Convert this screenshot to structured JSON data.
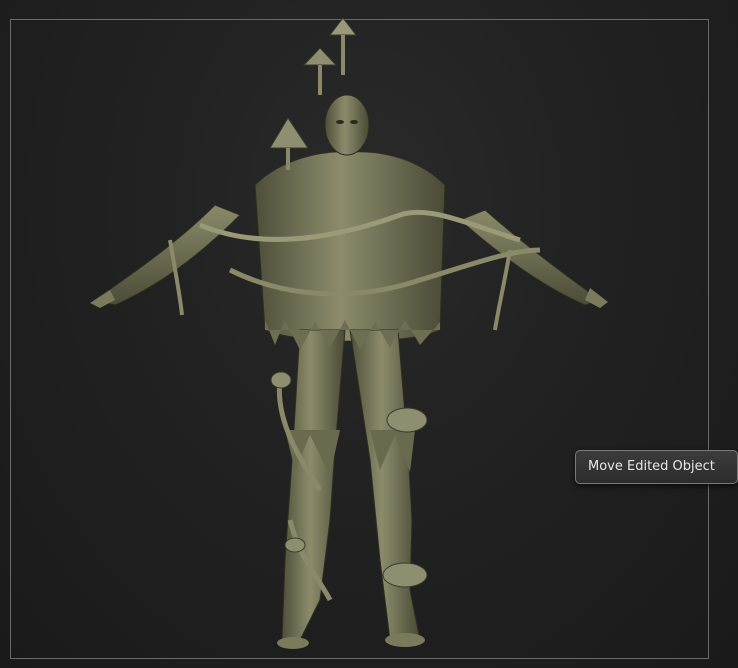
{
  "viewport": {
    "tooltip_text": "Move Edited Object",
    "background_color": "#1c1c1c",
    "model_color": "#8a8a6a"
  }
}
